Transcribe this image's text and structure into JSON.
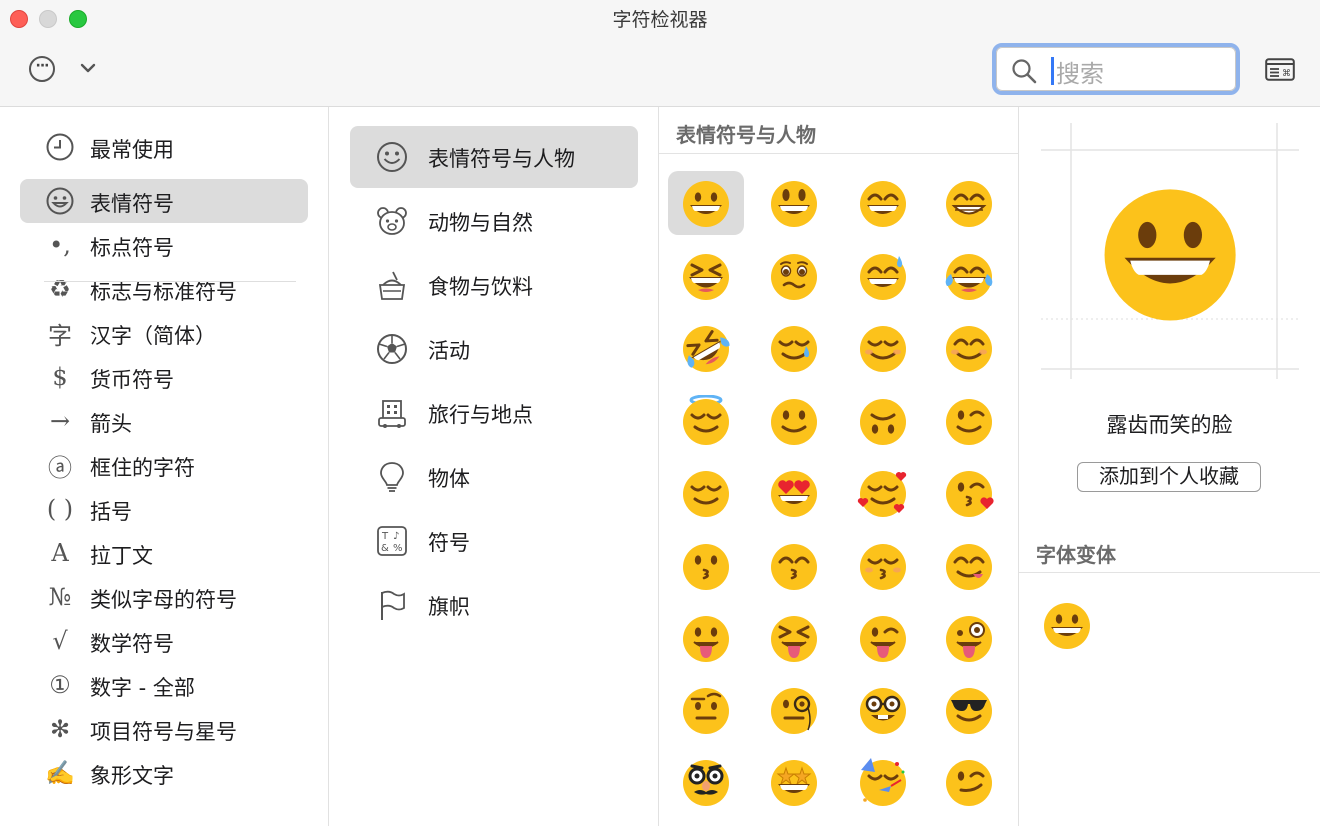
{
  "window": {
    "title": "字符检视器"
  },
  "search": {
    "placeholder": "搜索"
  },
  "categories": [
    {
      "label": "最常使用",
      "icon": "clock-icon",
      "glyph": ""
    },
    {
      "label": "表情符号",
      "icon": "smiley-icon",
      "glyph": ""
    },
    {
      "label": "标点符号",
      "icon": "punctuation-icon",
      "glyph": "•,"
    },
    {
      "label": "标志与标准符号",
      "icon": "recycle-icon",
      "glyph": "♻"
    },
    {
      "label": "汉字（简体）",
      "icon": "hanzi-icon",
      "glyph": "字"
    },
    {
      "label": "货币符号",
      "icon": "dollar-icon",
      "glyph": "$"
    },
    {
      "label": "箭头",
      "icon": "arrow-icon",
      "glyph": "→"
    },
    {
      "label": "框住的字符",
      "icon": "enclosed-a-icon",
      "glyph": "ⓐ"
    },
    {
      "label": "括号",
      "icon": "parentheses-icon",
      "glyph": "( )"
    },
    {
      "label": "拉丁文",
      "icon": "latin-a-icon",
      "glyph": "A"
    },
    {
      "label": "类似字母的符号",
      "icon": "numero-icon",
      "glyph": "№"
    },
    {
      "label": "数学符号",
      "icon": "sqrt-icon",
      "glyph": "√"
    },
    {
      "label": "数字 - 全部",
      "icon": "circled-one-icon",
      "glyph": "①"
    },
    {
      "label": "项目符号与星号",
      "icon": "asterisk-icon",
      "glyph": "✻"
    },
    {
      "label": "象形文字",
      "icon": "pictograph-icon",
      "glyph": "✍"
    }
  ],
  "selected_category": 1,
  "subcategories": [
    {
      "label": "表情符号与人物",
      "icon": "smiley-icon"
    },
    {
      "label": "动物与自然",
      "icon": "bear-icon"
    },
    {
      "label": "食物与饮料",
      "icon": "food-icon"
    },
    {
      "label": "活动",
      "icon": "soccer-ball-icon"
    },
    {
      "label": "旅行与地点",
      "icon": "building-icon"
    },
    {
      "label": "物体",
      "icon": "lightbulb-icon"
    },
    {
      "label": "符号",
      "icon": "symbols-icon"
    },
    {
      "label": "旗帜",
      "icon": "flag-icon"
    }
  ],
  "selected_subcategory": 0,
  "grid": {
    "title": "表情符号与人物",
    "emojis": [
      "grinning-face",
      "grinning-face-big-eyes",
      "grinning-face-smiling-eyes",
      "beaming-face",
      "grinning-squinting-face",
      "face-holding-back-tears",
      "grinning-face-sweat",
      "face-tears-of-joy",
      "rolling-on-floor-laughing",
      "smiling-face-with-tear",
      "smiling-face",
      "smiling-face-smiling-eyes",
      "smiling-face-halo",
      "slightly-smiling-face",
      "upside-down-face",
      "winking-face",
      "relieved-face",
      "heart-eyes",
      "smiling-face-hearts",
      "face-blowing-kiss",
      "kissing-face",
      "kissing-face-smiling-eyes",
      "kissing-face-closed-eyes",
      "face-savoring-food",
      "face-with-tongue",
      "squinting-face-tongue",
      "winking-face-tongue",
      "zany-face",
      "face-raised-eyebrow",
      "face-with-monocle",
      "nerd-face",
      "sunglasses-face",
      "disguised-face",
      "star-struck",
      "partying-face",
      "smirking-face"
    ],
    "selected_index": 0
  },
  "preview": {
    "name": "露齿而笑的脸",
    "favorite_label": "添加到个人收藏",
    "variants_title": "字体变体"
  },
  "colors": {
    "emoji_face": "#fcc21b",
    "emoji_dark": "#6b3d0c",
    "selection": "#dcdcdc",
    "focus_ring": "#8fb3ec"
  }
}
